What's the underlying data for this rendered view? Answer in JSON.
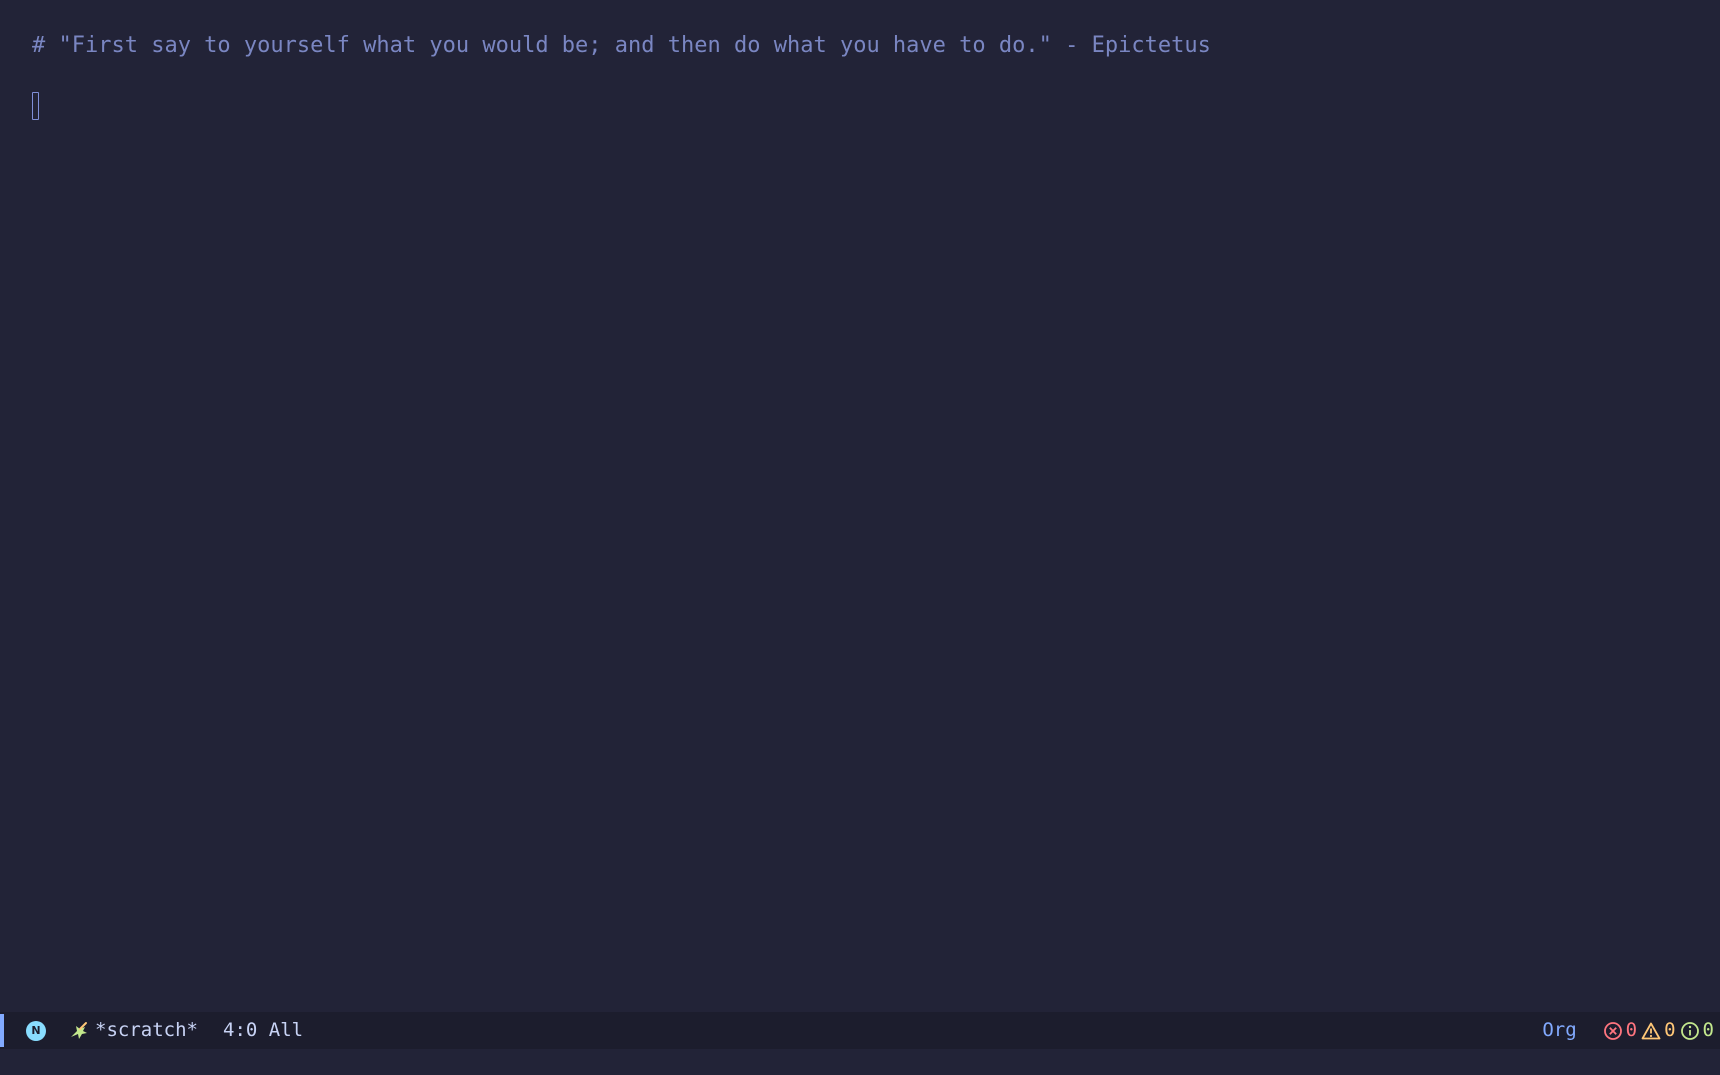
{
  "editor": {
    "comment_text": "# \"First say to yourself what you would be; and then do what you have to do.\" - Epictetus"
  },
  "modeline": {
    "evil_state": "N",
    "mode_icon": "unicorn-icon",
    "buffer_name": "*scratch*",
    "position": "4:0 All",
    "major_mode": "Org",
    "errors": "0",
    "warnings": "0",
    "infos": "0"
  },
  "colors": {
    "background": "#222337",
    "comment": "#7a86c2",
    "modeline_bg": "#1c1d2d",
    "accent": "#82aaff",
    "error": "#ff757f",
    "warning": "#ffc777",
    "info": "#c3e88d"
  }
}
